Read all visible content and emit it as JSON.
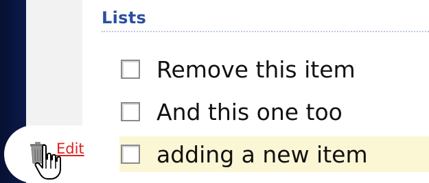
{
  "list": {
    "title": "Lists",
    "items": [
      {
        "label": "Remove this item",
        "checked": false
      },
      {
        "label": "And this one too",
        "checked": false
      },
      {
        "label": "adding a new item",
        "checked": false,
        "highlighted": true
      }
    ]
  },
  "actions": {
    "edit_label": "Edit"
  },
  "icons": {
    "trash": "trash-icon",
    "cursor": "hand-pointer-cursor-icon"
  },
  "colors": {
    "title": "#2a4fa0",
    "edit_link": "#e02020",
    "highlight": "#fbf6d4"
  }
}
